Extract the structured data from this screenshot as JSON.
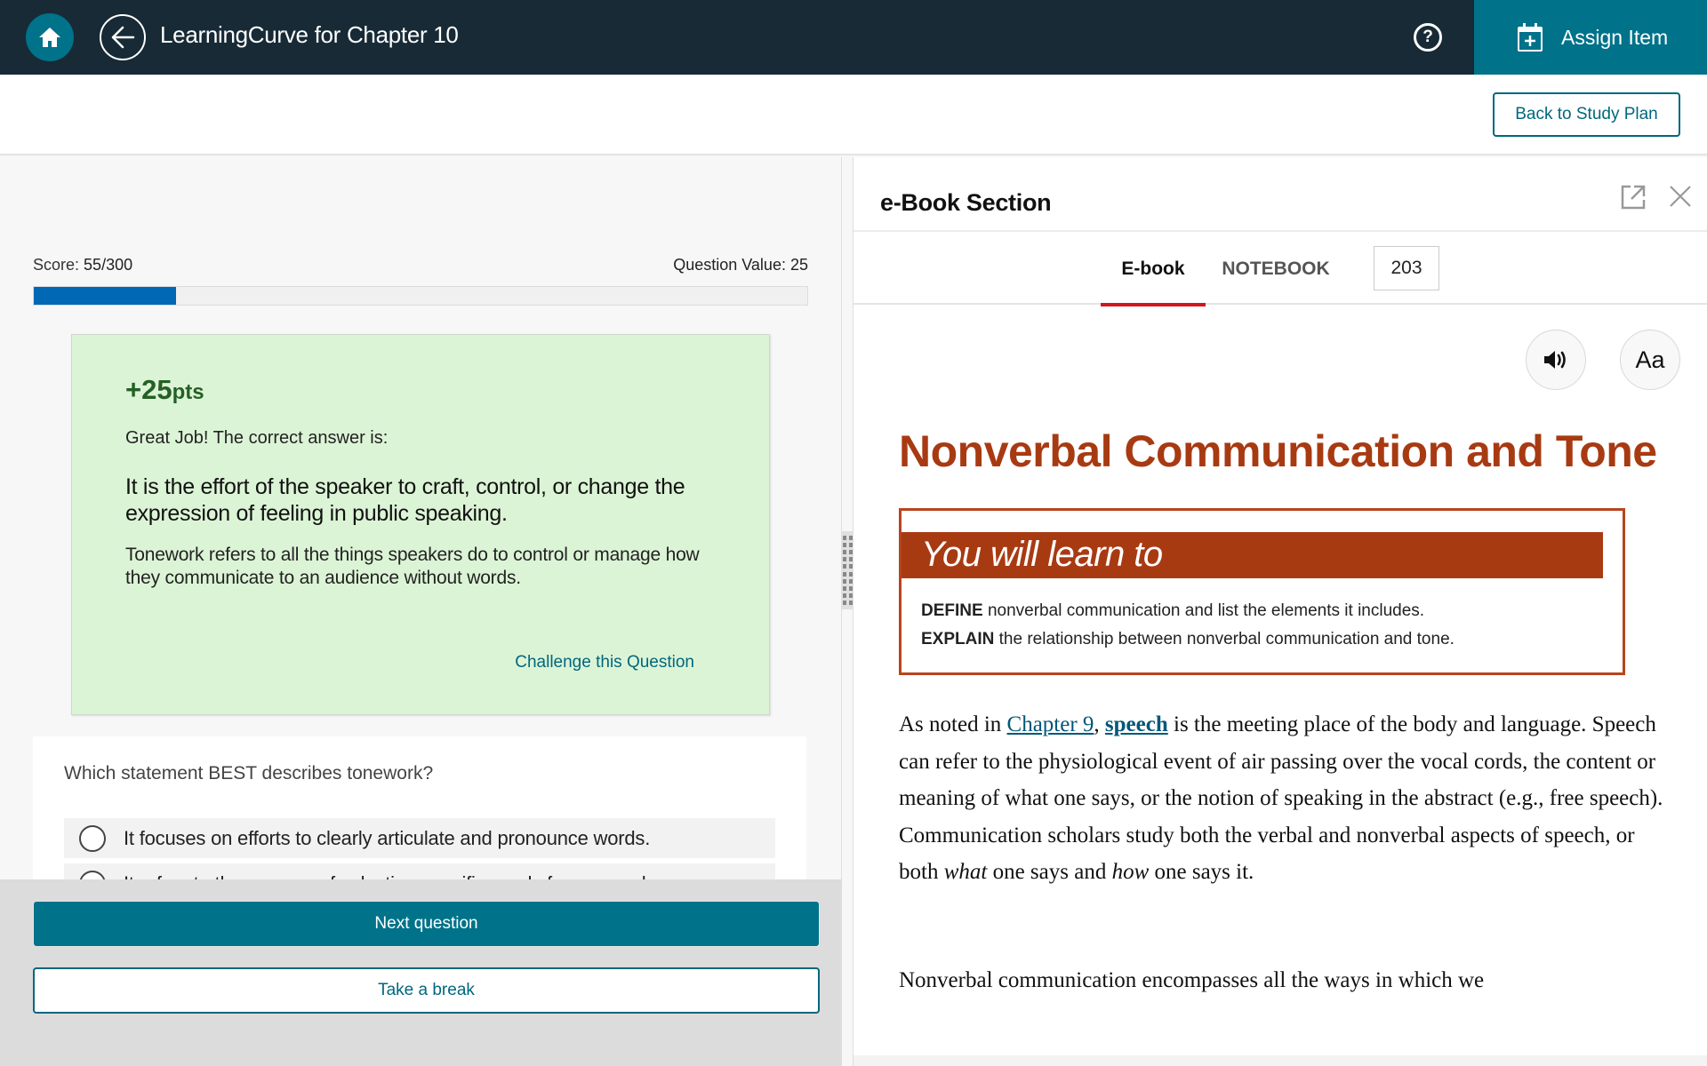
{
  "topbar": {
    "title": "LearningCurve for Chapter 10",
    "home_icon": "home-icon",
    "back_icon": "arrow-left-icon",
    "help_icon": "help-circle-icon",
    "assign_label": "Assign Item",
    "assign_icon": "calendar-plus-icon"
  },
  "subheader": {
    "back_to_study_plan": "Back to Study Plan"
  },
  "quiz": {
    "score_label": "Score:",
    "score_value": "55/300",
    "score_current": 55,
    "score_total": 300,
    "question_value_label": "Question Value:",
    "question_value": "25",
    "feedback": {
      "points_number": "+25",
      "points_unit": "pts",
      "message": "Great Job! The correct answer is:",
      "correct_answer": "It is the effort of the speaker to craft, control, or change the expression of feeling in public speaking.",
      "explanation": "Tonework refers to all the things speakers do to control or manage how they communicate to an audience without words.",
      "challenge_link": "Challenge this Question"
    },
    "question": "Which statement BEST describes tonework?",
    "options": [
      {
        "text": "It focuses on efforts to clearly articulate and pronounce words."
      },
      {
        "text": "It refers to the process of selecting specific words for a speech."
      }
    ],
    "next_button": "Next question",
    "break_button": "Take a break"
  },
  "ebook": {
    "panel_title": "e-Book Section",
    "popout_icon": "external-link-icon",
    "close_icon": "close-icon",
    "tabs": [
      {
        "label": "E-book",
        "active": true
      },
      {
        "label": "NOTEBOOK",
        "active": false
      }
    ],
    "page_number": "203",
    "audio_icon": "speaker-icon",
    "font_button": "Aa",
    "chapter_title": "Nonverbal Communication and Tone",
    "learn_heading": "You will learn to",
    "learn_items": [
      {
        "verb": "DEFINE",
        "text": " nonverbal communication and list the elements it includes."
      },
      {
        "verb": "EXPLAIN",
        "text": " the relationship between nonverbal communication and tone."
      }
    ],
    "paragraph1": {
      "pre": "As noted in ",
      "link1": "Chapter 9",
      "mid": ", ",
      "link2": "speech",
      "body": " is the meeting place of the body and language. Speech can refer to the physiological event of air passing over the vocal cords, the content or meaning of what one says, or the notion of speaking in the abstract (e.g., free speech). Communication scholars study both the verbal and nonverbal aspects of speech, or both ",
      "em1": "what",
      "body2": " one says and ",
      "em2": "how",
      "end": " one says it."
    },
    "paragraph2": "Nonverbal communication encompasses all the ways in which we"
  },
  "colors": {
    "topbar": "#172a36",
    "accent_teal": "#00728a",
    "progress_fill": "#0068b5",
    "feedback_bg": "#dcf4d6",
    "points_green": "#256025",
    "title_rust": "#a83a12",
    "tab_underline": "#d4151f"
  }
}
